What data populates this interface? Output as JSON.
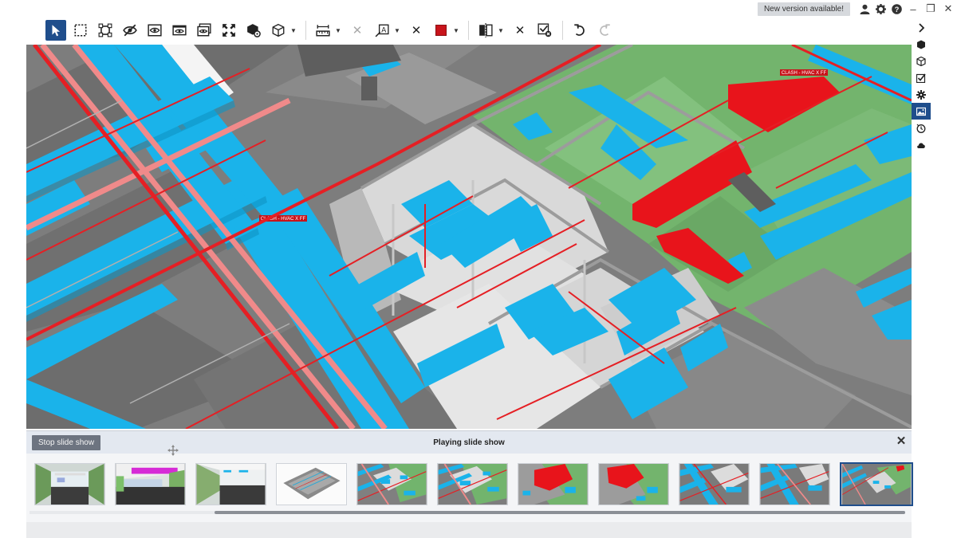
{
  "topbar": {
    "new_version": "New version available!",
    "icons": [
      "user-icon",
      "gear-icon",
      "help-icon"
    ],
    "window_controls": [
      "minimize",
      "restore",
      "close"
    ]
  },
  "toolbar": {
    "tools": [
      {
        "name": "select-tool",
        "active": true
      },
      {
        "name": "box-select-tool"
      },
      {
        "name": "fit-selection-tool"
      },
      {
        "name": "hide-tool"
      },
      {
        "name": "show-only-tool"
      },
      {
        "name": "show-all-tool"
      },
      {
        "name": "isolate-tool"
      },
      {
        "name": "fit-all-tool"
      },
      {
        "name": "object-properties-tool"
      },
      {
        "name": "view-cube-tool"
      },
      {
        "name": "measure-tool"
      },
      {
        "name": "clear-measure-tool"
      },
      {
        "name": "markup-tool"
      },
      {
        "name": "clear-markup-tool"
      },
      {
        "name": "color-tool",
        "color": "#c8141b"
      },
      {
        "name": "section-tool"
      },
      {
        "name": "clear-section-tool"
      },
      {
        "name": "clear-overrides-tool"
      },
      {
        "name": "undo-tool"
      },
      {
        "name": "redo-tool"
      }
    ]
  },
  "viewport": {
    "clash_labels": [
      "CLASH - HVAC X FF",
      "CLASH - HVAC X FF"
    ]
  },
  "rightbar": {
    "items": [
      "expand-chevron",
      "model-icon",
      "objects-icon",
      "checklist-icon",
      "settings-icon",
      "slides-icon",
      "history-icon",
      "cloud-icon"
    ],
    "active": "slides-icon"
  },
  "slideshow": {
    "stop_label": "Stop slide show",
    "title": "Playing slide show",
    "thumb_count": 11,
    "selected_index": 10
  },
  "colors": {
    "accent": "#1f4e8c",
    "duct_blue": "#1ab3ea",
    "pipe_red": "#e51f24",
    "pipe_pink": "#f08080",
    "wall_green": "#72b36e",
    "slab_gray": "#7a7a7a"
  }
}
